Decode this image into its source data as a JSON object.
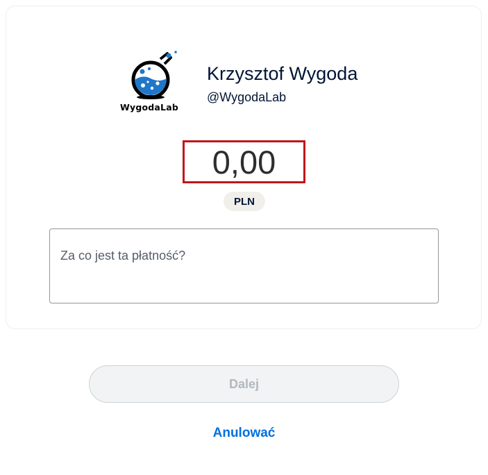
{
  "merchant": {
    "name": "Krzysztof Wygoda",
    "handle": "@WygodaLab",
    "logo_text": "WygodaLab",
    "logo_icon": "flask-icon"
  },
  "payment": {
    "amount": "0,00",
    "currency": "PLN",
    "note_placeholder": "Za co jest ta płatność?",
    "note_value": ""
  },
  "actions": {
    "next_label": "Dalej",
    "cancel_label": "Anulować"
  },
  "colors": {
    "amount_highlight": "#c0141a",
    "link": "#0070e0",
    "disabled_button_bg": "#f1f3f4",
    "disabled_button_text": "#b3b8bd",
    "flask_liquid": "#1f77c9"
  }
}
